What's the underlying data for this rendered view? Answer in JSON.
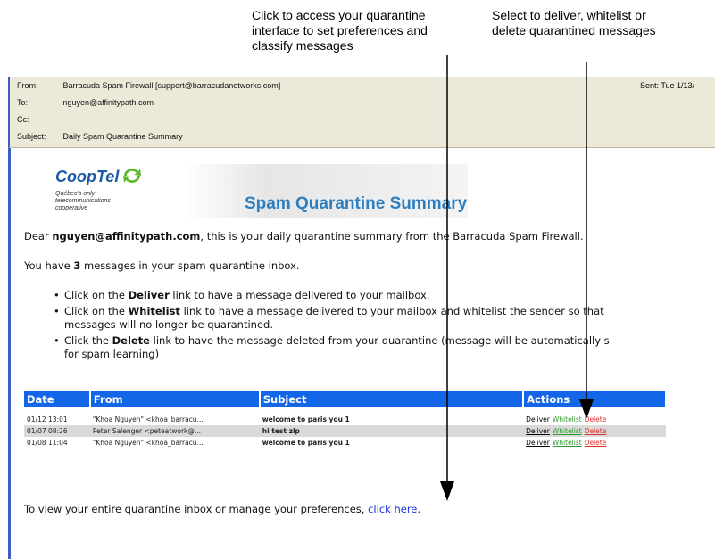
{
  "callouts": {
    "left": [
      "Click to access your quarantine",
      "interface to set preferences and",
      "classify messages"
    ],
    "right": [
      "Select to deliver, whitelist or",
      "delete quarantined messages"
    ]
  },
  "email_header": {
    "from_key": "From:",
    "from_value": "Barracuda Spam Firewall [support@barracudanetworks.com]",
    "to_key": "To:",
    "to_value": "nguyen@affinitypath.com",
    "cc_key": "Cc:",
    "cc_value": "",
    "subject_key": "Subject:",
    "subject_value": "Daily Spam Quarantine Summary",
    "sent": "Sent:  Tue 1/13/"
  },
  "banner": {
    "logo_name": "CoopTel",
    "logo_tagline": [
      "Québec's only",
      "telecommunications",
      "cooperative"
    ],
    "title": "Spam Quarantine Summary"
  },
  "body": {
    "greeting_prefix": "Dear ",
    "greeting_email": "nguyen@affinitypath.com",
    "greeting_suffix": ", this is your daily quarantine summary from the Barracuda Spam Firewall.",
    "count_prefix": "You have ",
    "count_value": "3",
    "count_suffix": " messages in your spam quarantine inbox.",
    "bullets": [
      {
        "pre": "Click on the ",
        "bold": "Deliver",
        "post": " link to have a message delivered to your mailbox."
      },
      {
        "pre": "Click on the ",
        "bold": "Whitelist",
        "post": " link to have a message delivered to your mailbox and whitelist the sender so that",
        "post2": "messages will no longer be quarantined."
      },
      {
        "pre": "Click the ",
        "bold": "Delete",
        "post": " link to have the message deleted from your quarantine (message will be automatically s",
        "post2": "for spam learning)"
      }
    ],
    "footer_text": "To view your entire quarantine inbox or manage your preferences, ",
    "footer_link": "click here",
    "footer_end": "."
  },
  "table": {
    "headers": [
      "Date",
      "From",
      "Subject",
      "Actions"
    ],
    "rows": [
      {
        "date": "01/12 13:01",
        "from": "\"Khoa Nguyen\" <khoa_barracu...",
        "subject": "welcome to paris you 1"
      },
      {
        "date": "01/07 08:26",
        "from": "Peter Salenger <peteatwork@...",
        "subject": "hi test zip"
      },
      {
        "date": "01/08 11:04",
        "from": "\"Khoa Nguyen\" <khoa_barracu...",
        "subject": "welcome to paris you 1"
      }
    ],
    "actions": {
      "deliver": "Deliver",
      "whitelist": "Whitelist",
      "delete": "Delete"
    }
  },
  "colors": {
    "table_header": "#1366e8",
    "banner_title": "#2d7fc0",
    "link": "#1d32d0",
    "whitelist": "#2f9a2f",
    "delete": "#e0302c",
    "logo_green": "#5cb82e"
  }
}
